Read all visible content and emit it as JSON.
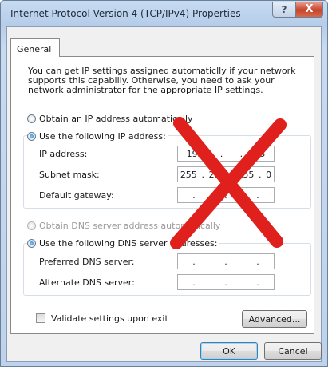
{
  "window": {
    "title": "Internet Protocol Version 4 (TCP/IPv4) Properties",
    "help_glyph": "?",
    "close_glyph": "X"
  },
  "tab": {
    "label": "General"
  },
  "description": "You can get IP settings assigned automaticlly if your network supports this capabiliy. Otherwise, you need to ask your network administrator for the appropriate IP settings.",
  "ip_section": {
    "auto_label": "Obtain an IP address automatically",
    "manual_label": "Use the following IP address:",
    "ip_label": "IP address:",
    "ip_octets": [
      "192",
      ".",
      ".",
      "5"
    ],
    "mask_label": "Subnet mask:",
    "mask_octets": [
      "255",
      ".",
      "255",
      ".",
      "255",
      ".",
      "0"
    ],
    "gateway_label": "Default gateway:",
    "gateway_octets": [
      ".",
      ".",
      "."
    ]
  },
  "dns_section": {
    "auto_label": "Obtain DNS server address automatically",
    "manual_label": "Use the following DNS server addresses:",
    "preferred_label": "Preferred DNS server:",
    "preferred_octets": [
      ".",
      ".",
      "."
    ],
    "alternate_label": "Alternate DNS server:",
    "alternate_octets": [
      ".",
      ".",
      "."
    ]
  },
  "validate_label": "Validate settings upon exit",
  "buttons": {
    "advanced": "Advanced...",
    "ok": "OK",
    "cancel": "Cancel"
  },
  "colors": {
    "x_mark": "#e0201c",
    "accent": "#1f78c8"
  }
}
